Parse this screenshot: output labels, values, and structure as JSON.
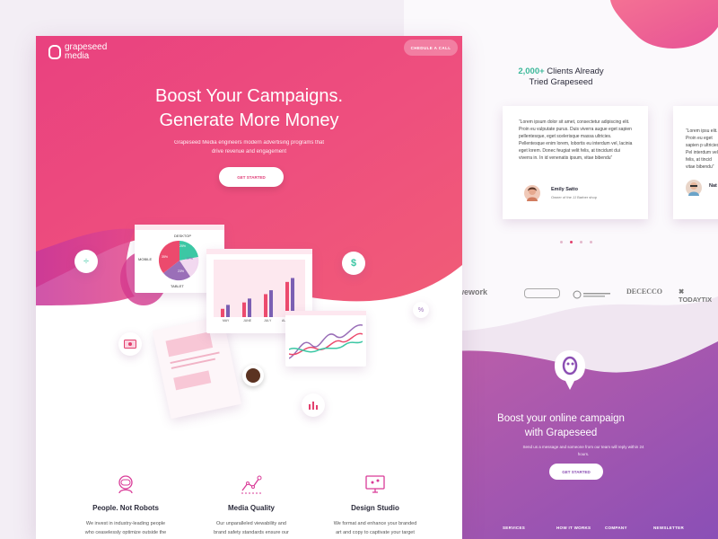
{
  "brand": {
    "name": "grapeseed media",
    "line1": "grapeseed",
    "line2": "media"
  },
  "header": {
    "cta_label": "CHEDULE A CALL"
  },
  "hero": {
    "title_line1": "Boost Your Campaigns.",
    "title_line2": "Generate More Money",
    "subtitle": "Grapeseed Media engineers modern advertising programs that drive revenue and engagement",
    "cta_label": "GET STARTED"
  },
  "illustration": {
    "pie_labels": {
      "desktop": "DESKTOP",
      "mobile": "MOBILE",
      "tablet": "TABLET",
      "p1": "35%",
      "p2": "25%",
      "p3": "17%",
      "p4": "23%"
    },
    "bar_labels": [
      "MAY",
      "JUNE",
      "JULY",
      "AUGUST"
    ],
    "bar_values": [
      0.25,
      0.38,
      0.55,
      0.8
    ],
    "icons": [
      "divide-icon",
      "dollar-icon",
      "percent-icon",
      "money-icon",
      "bar-chart-icon",
      "coffee-icon"
    ]
  },
  "features": [
    {
      "title": "People. Not Robots",
      "text_l1": "We invest in industry-leading people",
      "text_l2": "who ceaselessly optimize outside the",
      "icon": "astronaut-icon"
    },
    {
      "title": "Media Quality",
      "text_l1": "Our unparalleled viewability and",
      "text_l2": "brand safety standards ensure our",
      "icon": "line-graph-icon"
    },
    {
      "title": "Design Studio",
      "text_l1": "We format and enhance your branded",
      "text_l2": "art and copy to captivate your target",
      "icon": "monitor-icon"
    }
  ],
  "clients": {
    "count": "2,000+",
    "title_rest": "Clients Already",
    "title_line2": "Tried Grapeseed",
    "testimonials": [
      {
        "quote": "“Lorem ipsum dolor sit amet, consectetur adipiscing elit. Proin eu vulputate purus. Duis viverra augue eget sapien pellentesque, eget scelerisque massa ultricies. Pellentesque enim lorem, lobortis eu interdum vel, lacinia eget lorem. Donec feugiat velit felis, at tincidunt dui viverra in. In id venenatis ipsum, vitae bibendu”",
        "name": "Emily Satto",
        "role": "Owner of the JJ Barber shop"
      },
      {
        "quote": "“Lorem ipsu elit. Proin eu eget sapien p ultricies. Pel interdum vel, felis, at tincid vitae bibendu”",
        "name": "Nat",
        "role": ""
      }
    ]
  },
  "brands": [
    "wework",
    "DECECCO",
    "TODAYTIX"
  ],
  "cta_section": {
    "title_line1": "Boost your online campaign",
    "title_line2": "with Grapeseed",
    "subtitle": "Send us a message and someone from our team will reply within 24 hours.",
    "cta_label": "GET STARTED"
  },
  "footer": {
    "links": [
      "SERVICES",
      "HOW IT WORKS",
      "COMPANY",
      "NEWSLETTER"
    ]
  },
  "colors": {
    "pink": "#f2507a",
    "magenta": "#d93b98",
    "purple": "#8b4fb3",
    "teal": "#3cc7a4",
    "accent_text": "#3cb89a"
  }
}
